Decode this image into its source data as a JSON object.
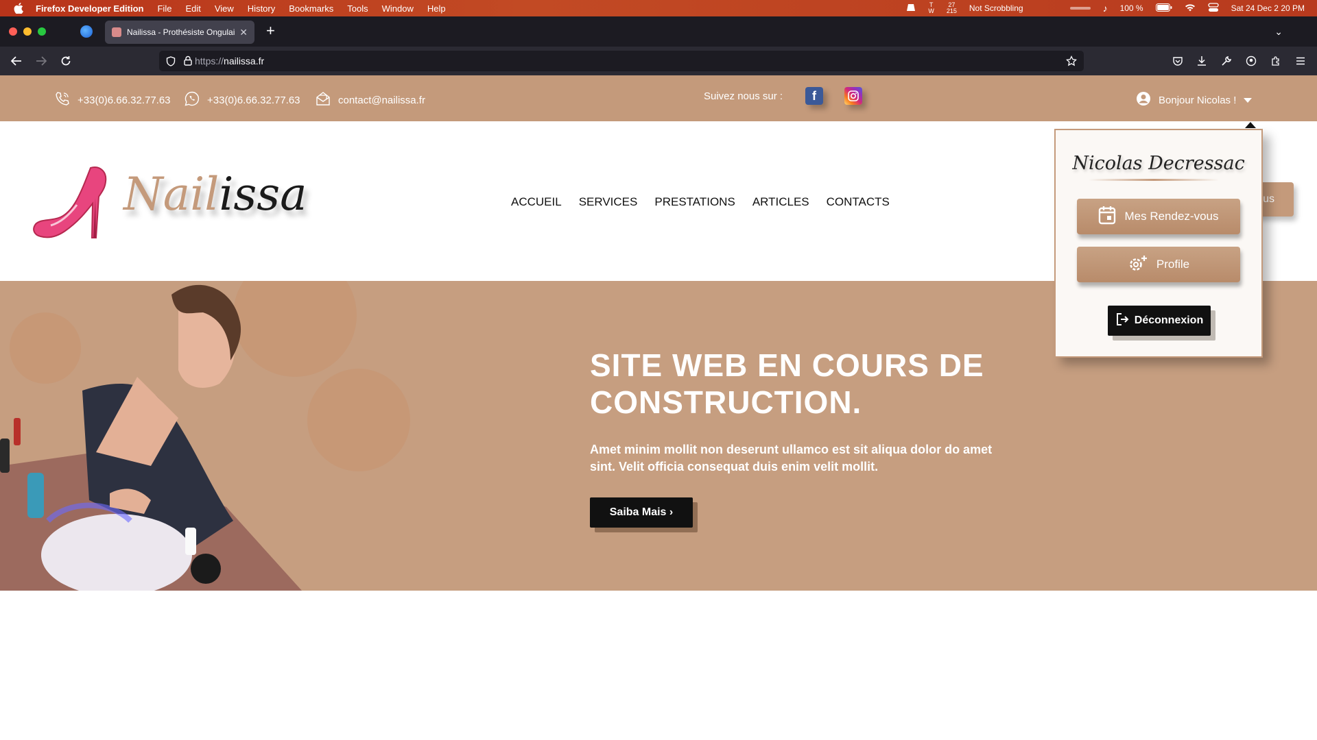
{
  "menubar": {
    "app_name": "Firefox Developer Edition",
    "menus": [
      "File",
      "Edit",
      "View",
      "History",
      "Bookmarks",
      "Tools",
      "Window",
      "Help"
    ],
    "status_tw": "T\nW",
    "status_counts": "27\n215",
    "scrobble": "Not Scrobbling",
    "battery": "100 %",
    "datetime": "Sat 24 Dec  2 20 PM"
  },
  "browser": {
    "tab_title": "Nailissa - Prothésiste Ongulaire",
    "url_scheme": "https://",
    "url_host": "nailissa.fr"
  },
  "topbar": {
    "phone": "+33(0)6.66.32.77.63",
    "whatsapp": "+33(0)6.66.32.77.63",
    "email": "contact@nailissa.fr",
    "follow_label": "Suivez nous sur :",
    "greeting": "Bonjour Nicolas !"
  },
  "header": {
    "logo_part1": "Nail",
    "logo_part2": "issa",
    "nav": [
      "ACCUEIL",
      "SERVICES",
      "PRESTATIONS",
      "ARTICLES",
      "CONTACTS"
    ],
    "cta_partial": "us"
  },
  "hero": {
    "title": "SITE WEB EN COURS DE CONSTRUCTION.",
    "text": "Amet minim mollit non deserunt ullamco est sit aliqua dolor do amet sint. Velit officia consequat duis enim velit mollit.",
    "button": "Saiba Mais ›"
  },
  "dropdown": {
    "name": "Nicolas Decressac",
    "appointments": "Mes Rendez-vous",
    "profile": "Profile",
    "logout": "Déconnexion"
  },
  "colors": {
    "brand": "#c49a7b",
    "dark": "#111111",
    "menubar": "#b8341a"
  }
}
